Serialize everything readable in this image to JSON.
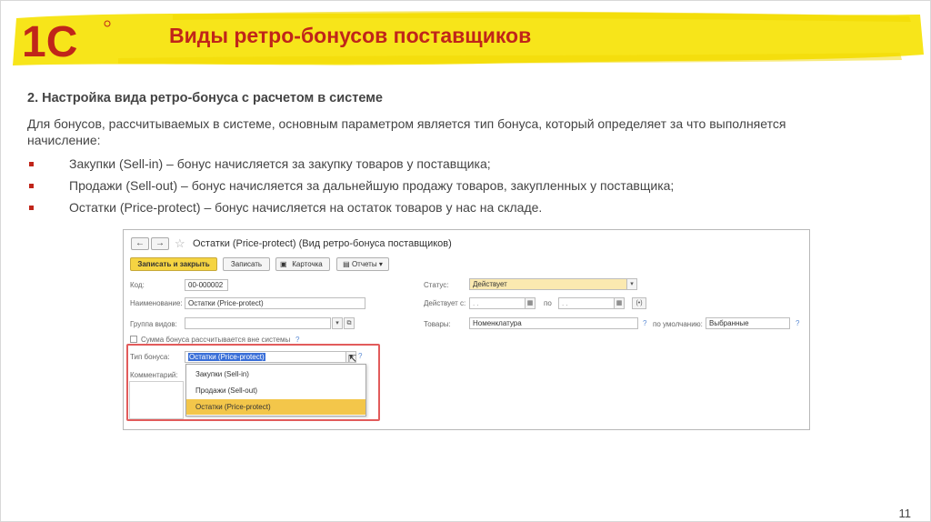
{
  "slide": {
    "title": "Виды ретро-бонусов поставщиков",
    "heading": "2. Настройка вида ретро-бонуса с расчетом в системе",
    "intro": "Для бонусов, рассчитываемых в системе, основным параметром является тип бонуса, который определяет за что выполняется начисление:",
    "bullets": [
      "Закупки (Sell-in) – бонус начисляется за закупку товаров у поставщика;",
      "Продажи (Sell-out) – бонус начисляется за дальнейшую продажу товаров, закупленных у поставщика;",
      "Остатки (Price-protect) – бонус начисляется на остаток товаров у нас на складе."
    ],
    "page_number": "11",
    "logo_text": "1С",
    "accent_color": "#c0251a",
    "brush_color": "#f5e200"
  },
  "window": {
    "title": "Остатки (Price-protect) (Вид ретро-бонуса поставщиков)",
    "nav_back": "←",
    "nav_forward": "→",
    "toolbar": {
      "save_close": "Записать и закрыть",
      "save": "Записать",
      "card": "Карточка",
      "reports": "Отчеты"
    },
    "fields": {
      "code_label": "Код:",
      "code_value": "00-000002",
      "name_label": "Наименование:",
      "name_value": "Остатки (Price-protect)",
      "group_label": "Группа видов:",
      "group_value": "",
      "checkbox_label": "Сумма бонуса рассчитывается вне системы",
      "bonus_type_label": "Тип бонуса:",
      "bonus_type_value": "Остатки (Price-protect)",
      "comment_label": "Комментарий:",
      "status_label": "Статус:",
      "status_value": "Действует",
      "valid_from_label": "Действует с:",
      "date_placeholder": ". .",
      "valid_to_label": "по",
      "goods_label": "Товары:",
      "goods_value": "Номенклатура",
      "default_label": "по умолчанию:",
      "default_value": "Выбранные",
      "help": "?"
    },
    "dropdown_options": [
      "Закупки (Sell-in)",
      "Продажи (Sell-out)",
      "Остатки (Price-protect)"
    ],
    "selected_option_index": 2
  }
}
